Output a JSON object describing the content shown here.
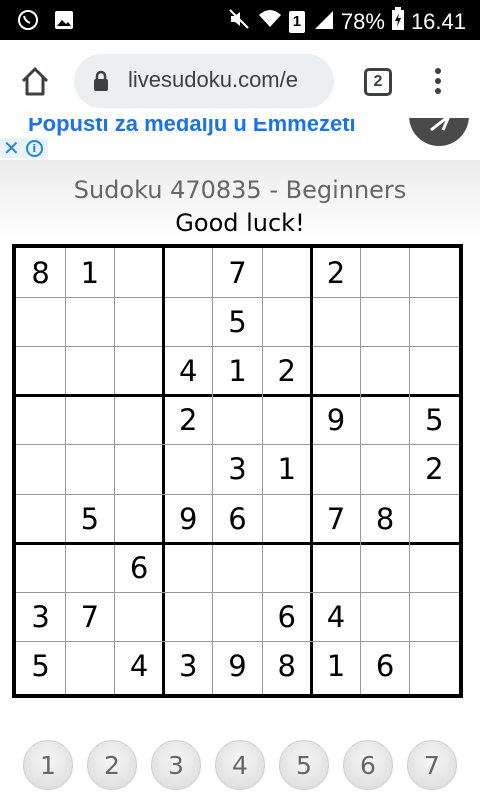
{
  "status_bar": {
    "sim_label": "1",
    "battery": "78%",
    "time": "16.41",
    "icons": [
      "viber-icon",
      "image-icon",
      "mute-icon",
      "wifi-icon",
      "sim-icon",
      "signal-icon",
      "battery-charging-icon"
    ]
  },
  "browser": {
    "url": "livesudoku.com/e",
    "tab_count": "2"
  },
  "ad": {
    "text": "Popusti za medalju u Emmezeti"
  },
  "page": {
    "title": "Sudoku 470835 - Beginners",
    "subtitle": "Good luck!"
  },
  "grid": [
    [
      "8",
      "1",
      "",
      "",
      "7",
      "",
      "2",
      "",
      ""
    ],
    [
      "",
      "",
      "",
      "",
      "5",
      "",
      "",
      "",
      ""
    ],
    [
      "",
      "",
      "",
      "4",
      "1",
      "2",
      "",
      "",
      ""
    ],
    [
      "",
      "",
      "",
      "2",
      "",
      "",
      "9",
      "",
      "5"
    ],
    [
      "",
      "",
      "",
      "",
      "3",
      "1",
      "",
      "",
      "2"
    ],
    [
      "",
      "5",
      "",
      "9",
      "6",
      "",
      "7",
      "8",
      ""
    ],
    [
      "",
      "",
      "6",
      "",
      "",
      "",
      "",
      "",
      ""
    ],
    [
      "3",
      "7",
      "",
      "",
      "",
      "6",
      "4",
      "",
      ""
    ],
    [
      "5",
      "",
      "4",
      "3",
      "9",
      "8",
      "1",
      "6",
      ""
    ]
  ],
  "numpad": [
    "1",
    "2",
    "3",
    "4",
    "5",
    "6",
    "7"
  ]
}
